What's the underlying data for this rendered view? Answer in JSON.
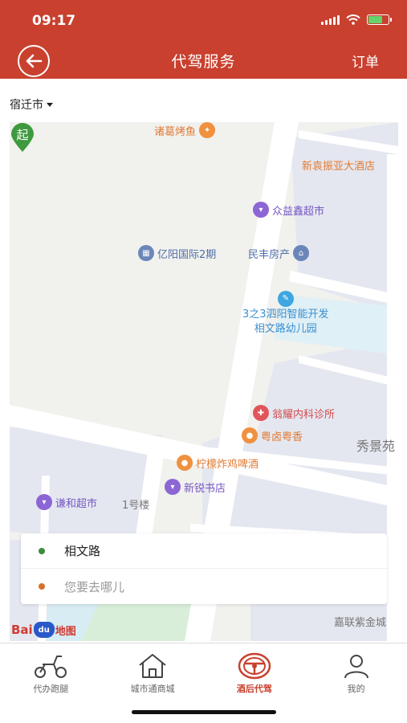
{
  "status_bar": {
    "time": "09:17"
  },
  "header": {
    "title": "代驾服务",
    "orders_label": "订单"
  },
  "city_selector": {
    "city": "宿迁市"
  },
  "map": {
    "pois": {
      "zhuge": "诸葛烤鱼",
      "xinyuan": "新袁振亚大酒店",
      "zhongyi": "众益鑫超市",
      "yiyang": "亿阳国际2期",
      "minfeng": "民丰房产",
      "youeryuan_line1": "3之3泗阳智能开发",
      "youeryuan_line2": "相文路幼儿园",
      "wengyao": "翁耀内科诊所",
      "yuelu": "粤卤粤香",
      "xiujing": "秀景苑",
      "ningmeng": "柠檬炸鸡啤酒",
      "xinrui": "新锐书店",
      "qianhe": "谦和超市",
      "yihaolou": "1号楼",
      "jialian": "嘉联紫金城"
    },
    "start_marker_label": "起",
    "baidu_logo": {
      "part1": "Bai",
      "paw": "du",
      "part2": "地图"
    }
  },
  "route": {
    "from": "相文路",
    "to_placeholder": "您要去哪儿",
    "from_color": "#3a8d3a",
    "to_color": "#d8702a"
  },
  "tabbar": {
    "tabs": [
      {
        "label": "代办跑腿",
        "icon": "scooter-icon"
      },
      {
        "label": "城市通商城",
        "icon": "house-icon"
      },
      {
        "label": "酒后代驾",
        "icon": "steering-wheel-icon",
        "active": true
      },
      {
        "label": "我的",
        "icon": "person-icon"
      }
    ]
  },
  "colors": {
    "brand": "#c9402f"
  }
}
